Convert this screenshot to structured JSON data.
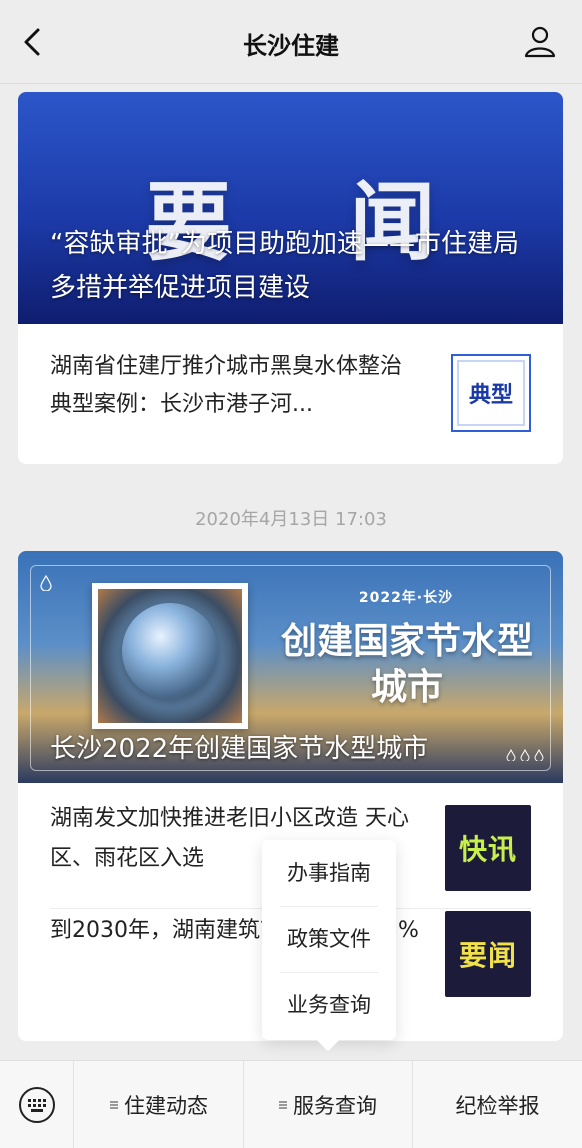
{
  "header": {
    "title": "长沙住建",
    "back_icon": "chevron-left-icon",
    "profile_icon": "person-icon"
  },
  "article1": {
    "banner_word": "要 闻",
    "caption": "“容缺审批”为项目助跑加速——市住建局多措并举促进项目建设",
    "items": [
      {
        "title": "湖南省住建厅推介城市黑臭水体整治典型案例：长沙市港子河...",
        "thumb_label": "典型"
      }
    ]
  },
  "timestamp": "2020年4月13日 17:03",
  "article2": {
    "banner_sub": "2022年·长沙",
    "banner_headline": "创建国家节水型城市",
    "caption": "长沙2022年创建国家节水型城市",
    "items": [
      {
        "title": "湖南发文加快推进老旧小区改造 天心区、雨花区入选",
        "thumb_label": "快讯"
      },
      {
        "title": "到2030年，湖南建筑节能率将达85%",
        "thumb_label": "要闻"
      }
    ]
  },
  "popup": {
    "items": [
      "办事指南",
      "政策文件",
      "业务查询"
    ]
  },
  "bottom_bar": {
    "keyboard_icon": "keyboard-icon",
    "tabs": [
      "住建动态",
      "服务查询",
      "纪检举报"
    ]
  },
  "colors": {
    "banner1": "#1c3aa8",
    "accent_kuaixun": "#c8f04a",
    "accent_yaowen": "#f2e24a",
    "background": "#ededed"
  }
}
